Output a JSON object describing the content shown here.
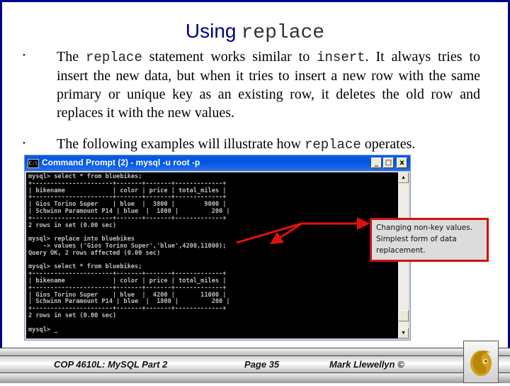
{
  "slide": {
    "title_sans": "Using",
    "title_mono": "replace",
    "bullets": [
      {
        "parts": [
          "The ",
          "replace",
          " statement works similar to ",
          "insert",
          ".  It always tries to insert the new data, but when it tries to insert a new row with the same primary or unique key as an existing row, it deletes the old row and replaces it with the new values."
        ]
      },
      {
        "parts": [
          "The following examples will illustrate  how ",
          "replace",
          " operates."
        ]
      }
    ],
    "bullet_glyph": "•"
  },
  "window": {
    "title": "Command Prompt (2) - mysql -u root -p",
    "icon": "C:\\",
    "buttons": {
      "minimize": "_",
      "maximize": "□",
      "close": "x"
    },
    "console_lines": [
      "mysql> select * from bluebikes;",
      "+----------------------+-------+-------+-------------+",
      "| bikename             | color | price | total_miles |",
      "+----------------------+-------+-------+-------------+",
      "| Gios Torino Super    | blue  |  3800 |        9000 |",
      "| Schwinn Paramount P14 | blue  |  1800 |         200 |",
      "+----------------------+-------+-------+-------------+",
      "2 rows in set (0.00 sec)",
      "",
      "mysql> replace into bluebikes",
      "    -> values ('Gios Torino Super','blue',4200,11000);",
      "Query OK, 2 rows affected (0.00 sec)",
      "",
      "mysql> select * from bluebikes;",
      "+----------------------+-------+-------+-------------+",
      "| bikename             | color | price | total_miles |",
      "+----------------------+-------+-------+-------------+",
      "| Gios Torino Super    | blue  |  4200 |       11000 |",
      "| Schwinn Paramount P14 | blue  |  1800 |         200 |",
      "+----------------------+-------+-------+-------------+",
      "2 rows in set (0.00 sec)",
      "",
      "mysql> _"
    ],
    "scroll": {
      "up": "▲",
      "down": "▼",
      "position_fraction": 0.95
    }
  },
  "callout": {
    "text": "Changing non-key values. Simplest form of data replacement.",
    "border_color": "#d01010"
  },
  "footer": {
    "course": "COP 4610L: MySQL Part 2",
    "page": "Page 35",
    "author": "Mark Llewellyn ©"
  },
  "colors": {
    "slide_border": "#00008b",
    "title": "#000080",
    "titlebar": "#0054e3",
    "arrow": "#e01010",
    "logo_gold": "#d4a017"
  }
}
